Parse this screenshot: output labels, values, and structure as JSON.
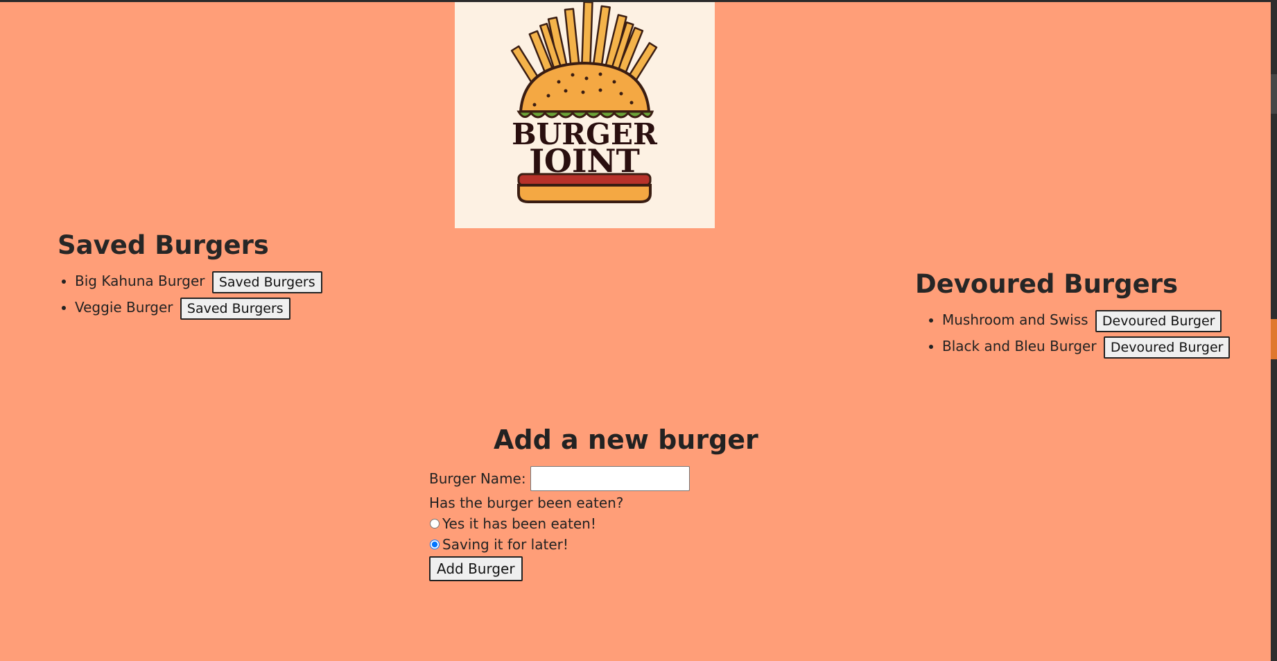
{
  "logo": {
    "alt": "Burger Joint logo",
    "line1": "BURGER",
    "line2": "JOINT"
  },
  "saved": {
    "title": "Saved Burgers",
    "items": [
      {
        "name": "Big Kahuna Burger",
        "button": "Saved Burgers"
      },
      {
        "name": "Veggie Burger",
        "button": "Saved Burgers"
      }
    ]
  },
  "devoured": {
    "title": "Devoured Burgers",
    "items": [
      {
        "name": "Mushroom and Swiss",
        "button": "Devoured Burger"
      },
      {
        "name": "Black and Bleu Burger",
        "button": "Devoured Burger"
      }
    ]
  },
  "form": {
    "title": "Add a new burger",
    "name_label": "Burger Name:",
    "name_value": "",
    "question": "Has the burger been eaten?",
    "option_eaten": "Yes it has been eaten!",
    "option_later": "Saving it for later!",
    "selected": "later",
    "submit": "Add Burger"
  },
  "colors": {
    "background": "#ff9e78",
    "logo_bg": "#fdf1e3",
    "scroll_marker": "#e0782d"
  }
}
